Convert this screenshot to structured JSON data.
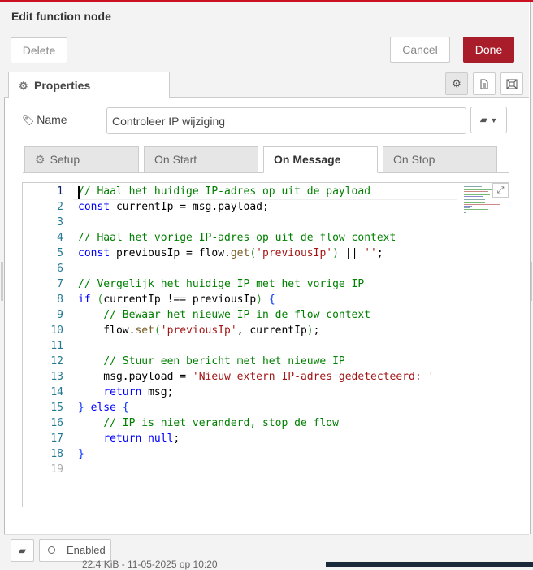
{
  "dialog": {
    "title": "Edit function node",
    "delete_label": "Delete",
    "cancel_label": "Cancel",
    "done_label": "Done",
    "accent_color": "#a91d2b"
  },
  "tabs": {
    "properties_label": "Properties",
    "icons": [
      "gear-icon",
      "description-icon",
      "appearance-icon"
    ]
  },
  "name": {
    "label": "Name",
    "value": "Controleer IP wijziging"
  },
  "subtabs": {
    "setup": "Setup",
    "on_start": "On Start",
    "on_message": "On Message",
    "on_stop": "On Stop",
    "active": "On Message"
  },
  "editor": {
    "line_numbers": [
      "1",
      "2",
      "3",
      "4",
      "5",
      "6",
      "7",
      "8",
      "9",
      "10",
      "11",
      "12",
      "13",
      "14",
      "15",
      "16",
      "17",
      "18",
      "19"
    ],
    "current_line": 1
  },
  "footer": {
    "enabled_label": "Enabled"
  },
  "background": {
    "partial_text": "22.4 KiB - 11-05-2025 op 10:20"
  }
}
